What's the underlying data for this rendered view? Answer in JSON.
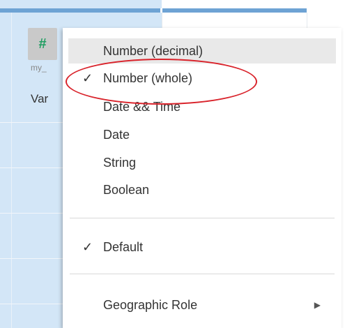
{
  "field": {
    "type_icon": "#",
    "source_label": "my_",
    "name_label": "Var"
  },
  "menu": {
    "items": [
      {
        "label": "Number (decimal)",
        "checked": false
      },
      {
        "label": "Number (whole)",
        "checked": true
      },
      {
        "label": "Date && Time",
        "checked": false
      },
      {
        "label": "Date",
        "checked": false
      },
      {
        "label": "String",
        "checked": false
      },
      {
        "label": "Boolean",
        "checked": false
      },
      {
        "label": "Default",
        "checked": true
      },
      {
        "label": "Geographic Role",
        "checked": false
      }
    ],
    "check_glyph": "✓",
    "submenu_arrow": "▶"
  },
  "colors": {
    "annotation_circle": "#d9232b",
    "type_icon_green": "#1f9e61",
    "column_highlight": "#d3e6f7"
  }
}
